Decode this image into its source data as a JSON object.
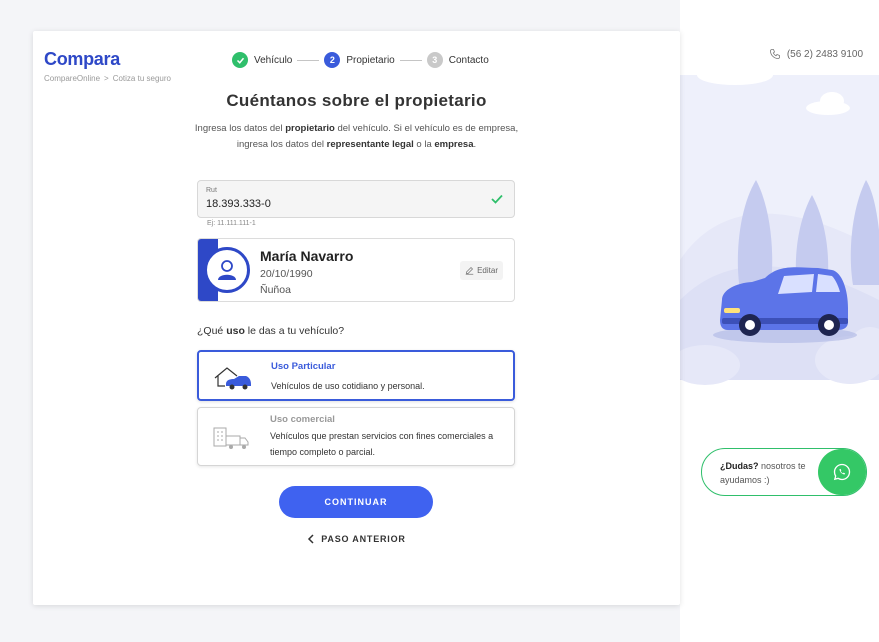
{
  "brand": {
    "logo": "Compara",
    "accent": "#2e48c7"
  },
  "breadcrumb": {
    "root": "CompareOnline",
    "separator": ">",
    "current": "Cotiza tu seguro"
  },
  "phone": {
    "icon": "phone-icon",
    "number": "(56 2) 2483 9100"
  },
  "stepper": {
    "steps": [
      {
        "label": "Vehículo",
        "number": "",
        "state": "done"
      },
      {
        "label": "Propietario",
        "number": "2",
        "state": "active"
      },
      {
        "label": "Contacto",
        "number": "3",
        "state": "inactive"
      }
    ]
  },
  "page": {
    "title": "Cuéntanos sobre el propietario",
    "desc_1": "Ingresa los datos del ",
    "desc_b1": "propietario",
    "desc_2": " del vehículo. Si el vehículo es de empresa, ingresa los datos del ",
    "desc_b2": "representante legal",
    "desc_3": " o la ",
    "desc_b3": "empresa",
    "desc_4": "."
  },
  "rut": {
    "label": "Rut",
    "value": "18.393.333-0",
    "hint": "Ej: 11.111.111-1"
  },
  "owner": {
    "name": "María Navarro",
    "birthdate": "20/10/1990",
    "commune": "Ñuñoa",
    "edit_label": "Editar"
  },
  "usage": {
    "q_pre": "¿Qué ",
    "q_bold": "uso",
    "q_post": " le das a tu vehículo?",
    "options": [
      {
        "title": "Uso Particular",
        "desc": "Vehículos de uso cotidiano y personal.",
        "selected": true,
        "icon": "home-car-icon"
      },
      {
        "title": "Uso comercial",
        "desc": "Vehículos que prestan servicios con fines comerciales a tiempo completo o parcial.",
        "selected": false,
        "icon": "building-truck-icon"
      }
    ]
  },
  "actions": {
    "continue": "CONTINUAR",
    "back": "PASO ANTERIOR"
  },
  "help": {
    "bold": "¿Dudas?",
    "text": " nosotros te ayudamos :)",
    "icon": "whatsapp-icon"
  },
  "colors": {
    "primary_button": "#3f62f0",
    "success": "#2fbf6b",
    "whatsapp": "#34c866"
  }
}
